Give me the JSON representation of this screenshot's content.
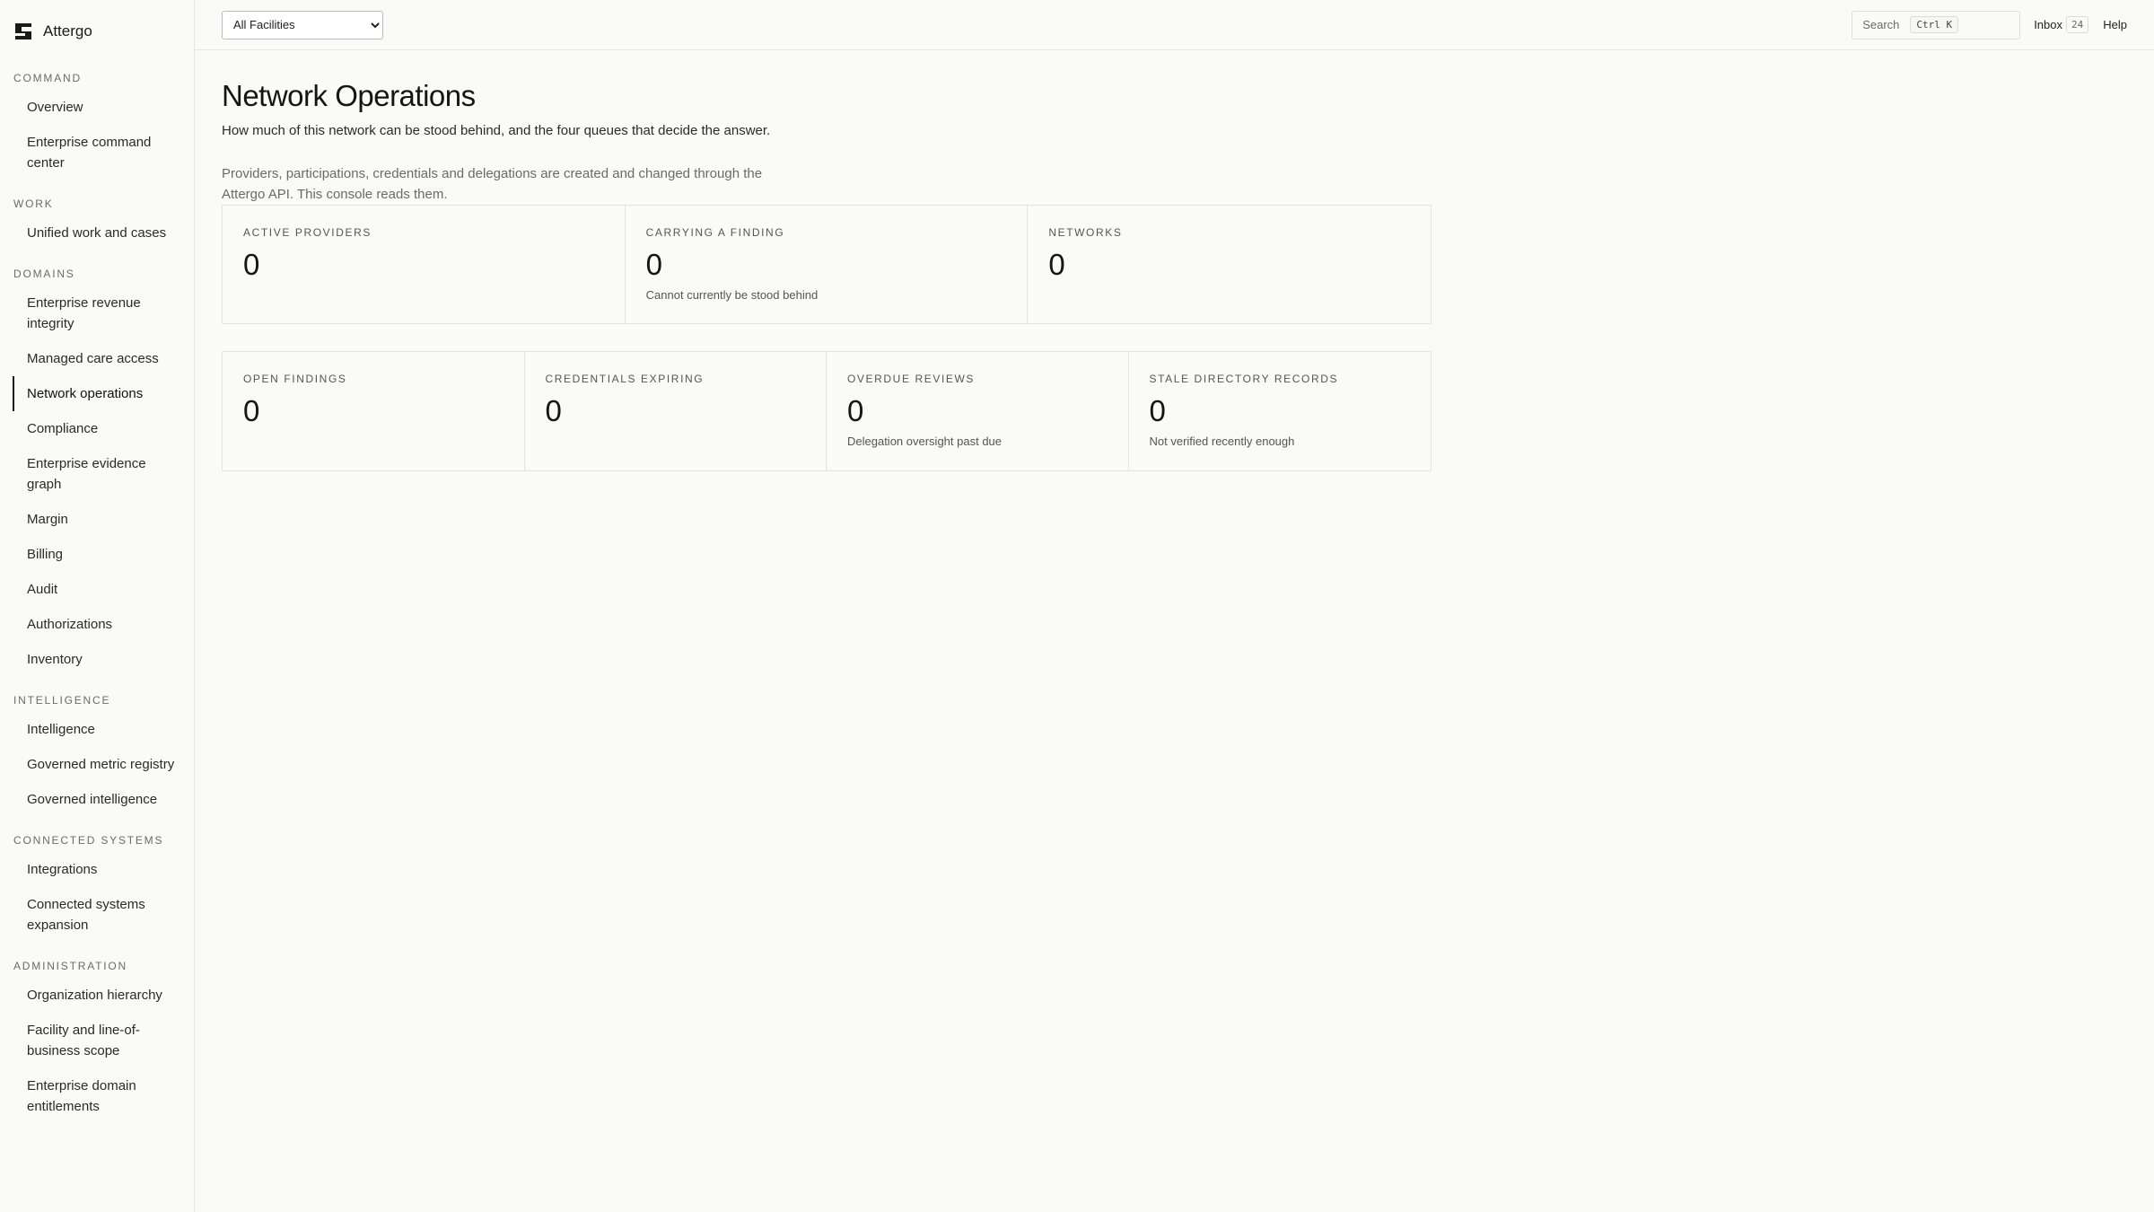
{
  "brand": {
    "name": "Attergo"
  },
  "sidebar": {
    "sections": [
      {
        "label": "COMMAND",
        "items": [
          "Overview",
          "Enterprise command center"
        ]
      },
      {
        "label": "WORK",
        "items": [
          "Unified work and cases"
        ]
      },
      {
        "label": "DOMAINS",
        "items": [
          "Enterprise revenue integrity",
          "Managed care access",
          "Network operations",
          "Compliance",
          "Enterprise evidence graph",
          "Margin",
          "Billing",
          "Audit",
          "Authorizations",
          "Inventory"
        ]
      },
      {
        "label": "INTELLIGENCE",
        "items": [
          "Intelligence",
          "Governed metric registry",
          "Governed intelligence"
        ]
      },
      {
        "label": "CONNECTED SYSTEMS",
        "items": [
          "Integrations",
          "Connected systems expansion"
        ]
      },
      {
        "label": "ADMINISTRATION",
        "items": [
          "Organization hierarchy",
          "Facility and line-of-business scope",
          "Enterprise domain entitlements"
        ]
      }
    ],
    "active_item": "Network operations"
  },
  "topbar": {
    "facility_select": "All Facilities",
    "search_label": "Search",
    "search_shortcut": "Ctrl K",
    "inbox_label": "Inbox",
    "inbox_count": "24",
    "help_label": "Help"
  },
  "page": {
    "title": "Network Operations",
    "subtitle": "How much of this network can be stood behind, and the four queues that decide the answer.",
    "note": "Providers, participations, credentials and delegations are created and changed through the Attergo API. This console reads them."
  },
  "stats_top": [
    {
      "label": "ACTIVE PROVIDERS",
      "value": "0",
      "desc": ""
    },
    {
      "label": "CARRYING A FINDING",
      "value": "0",
      "desc": "Cannot currently be stood behind"
    },
    {
      "label": "NETWORKS",
      "value": "0",
      "desc": ""
    }
  ],
  "stats_bottom": [
    {
      "label": "OPEN FINDINGS",
      "value": "0",
      "desc": ""
    },
    {
      "label": "CREDENTIALS EXPIRING",
      "value": "0",
      "desc": ""
    },
    {
      "label": "OVERDUE REVIEWS",
      "value": "0",
      "desc": "Delegation oversight past due"
    },
    {
      "label": "STALE DIRECTORY RECORDS",
      "value": "0",
      "desc": "Not verified recently enough"
    }
  ]
}
